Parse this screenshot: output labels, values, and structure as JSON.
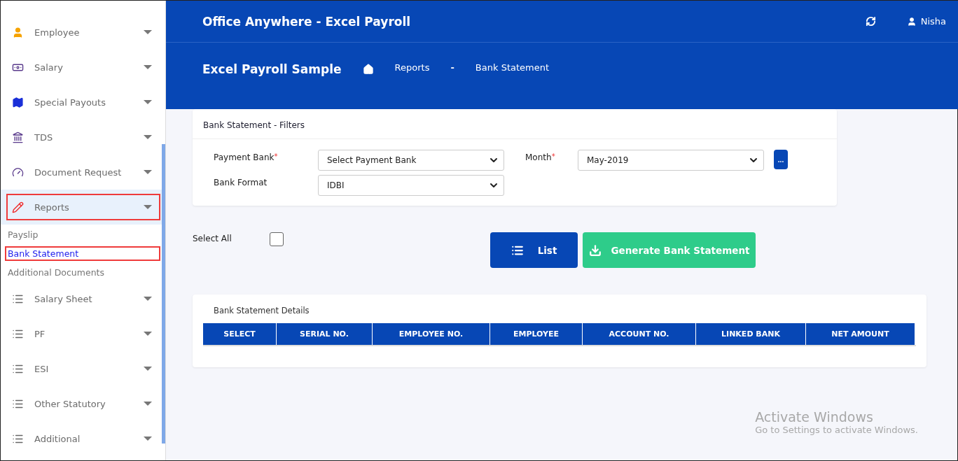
{
  "sidebar": {
    "items": [
      {
        "label": "Employee",
        "selected": false
      },
      {
        "label": "Salary",
        "selected": false
      },
      {
        "label": "Special Payouts",
        "selected": false
      },
      {
        "label": "TDS",
        "selected": false
      },
      {
        "label": "Document Request",
        "selected": false
      },
      {
        "label": "Reports",
        "selected": true,
        "children": [
          {
            "label": "Payslip",
            "selected": false
          },
          {
            "label": "Bank Statement",
            "selected": true
          },
          {
            "label": "Additional Documents",
            "selected": false
          }
        ]
      },
      {
        "label": "Salary Sheet",
        "selected": false
      },
      {
        "label": "PF",
        "selected": false
      },
      {
        "label": "ESI",
        "selected": false
      },
      {
        "label": "Other Statutory",
        "selected": false
      },
      {
        "label": "Additional",
        "selected": false
      }
    ]
  },
  "header": {
    "title": "Office Anywhere - Excel Payroll",
    "user": "Nisha"
  },
  "breadcrumb": {
    "company": "Excel Payroll Sample",
    "items": [
      "Reports",
      "Bank Statement"
    ],
    "separator": "-"
  },
  "filters": {
    "title": "Bank Statement - Filters",
    "fields": [
      {
        "label": "Payment Bank",
        "required_mark": "*",
        "value": "Select Payment Bank"
      },
      {
        "label": "Bank Format",
        "value": "IDBI"
      },
      {
        "label": "Month",
        "required_mark": "*",
        "value": "May-2019"
      }
    ],
    "more_button": "..."
  },
  "select_all": {
    "label": "Select All",
    "checked": false
  },
  "buttons": [
    {
      "label": "List",
      "kind": "list"
    },
    {
      "label": "Generate Bank Statement",
      "kind": "generate"
    }
  ],
  "details": {
    "title": "Bank Statement Details",
    "columns": [
      "SELECT",
      "SERIAL NO.",
      "EMPLOYEE NO.",
      "EMPLOYEE",
      "ACCOUNT NO.",
      "LINKED BANK",
      "NET AMOUNT"
    ]
  },
  "os_notice": {
    "title": "Activate Windows",
    "text": "Go to Settings to activate Windows."
  }
}
